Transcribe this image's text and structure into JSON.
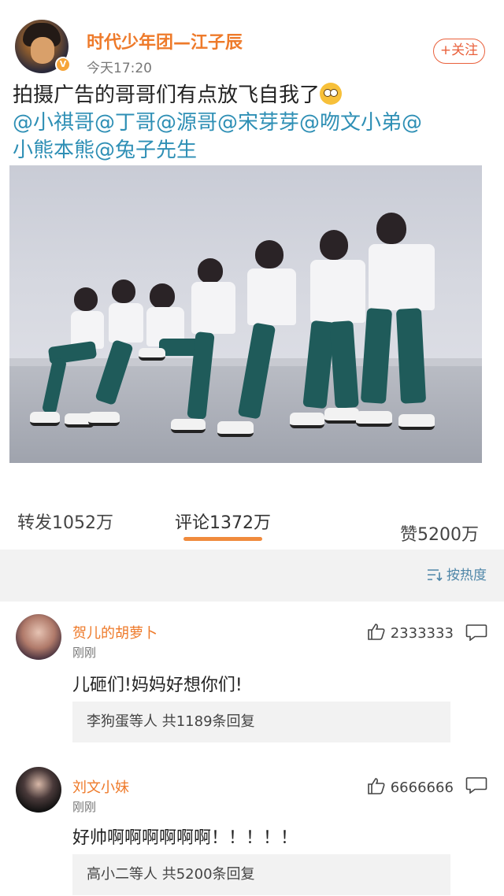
{
  "post": {
    "author": "时代少年团—江子辰",
    "verified_badge": "V",
    "time": "今天17:20",
    "follow_label": "+关注",
    "text": "拍摄广告的哥哥们有点放飞自我了",
    "mentions_line1": "@小祺哥@丁哥@源哥@宋芽芽@吻文小弟@",
    "mentions_line2": "小熊本熊@兔子先生"
  },
  "stats": {
    "repost": "转发1052万",
    "comments": "评论1372万",
    "likes": "赞5200万"
  },
  "sort": {
    "label": "按热度"
  },
  "comments": [
    {
      "name": "贺儿的胡萝卜",
      "time": "刚刚",
      "likes": "2333333",
      "text": "儿砸们!妈妈好想你们!",
      "replies": "李狗蛋等人 共1189条回复"
    },
    {
      "name": "刘文小妹",
      "time": "刚刚",
      "likes": "6666666",
      "text": "好帅啊啊啊啊啊啊！！！！！",
      "replies": "高小二等人 共5200条回复"
    }
  ]
}
